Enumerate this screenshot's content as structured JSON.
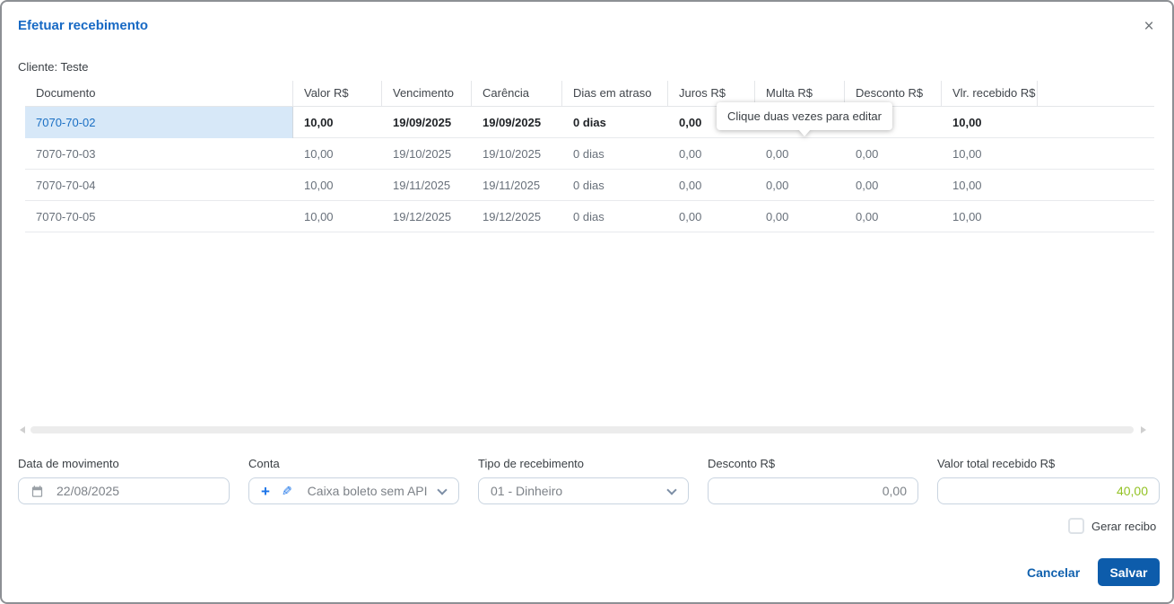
{
  "dialog": {
    "title": "Efetuar recebimento",
    "client_label": "Cliente: Teste"
  },
  "icons": {
    "close": "×",
    "plus": "+",
    "pencil": "✎"
  },
  "table": {
    "columns": [
      "Documento",
      "Valor R$",
      "Vencimento",
      "Carência",
      "Dias em atraso",
      "Juros R$",
      "Multa R$",
      "Desconto R$",
      "Vlr. recebido R$"
    ],
    "tooltip": "Clique duas vezes para editar",
    "rows": [
      {
        "documento": "7070-70-02",
        "valor": "10,00",
        "vencimento": "19/09/2025",
        "carencia": "19/09/2025",
        "dias": "0 dias",
        "juros": "0,00",
        "multa": "",
        "desconto": "",
        "recebido": "10,00"
      },
      {
        "documento": "7070-70-03",
        "valor": "10,00",
        "vencimento": "19/10/2025",
        "carencia": "19/10/2025",
        "dias": "0 dias",
        "juros": "0,00",
        "multa": "0,00",
        "desconto": "0,00",
        "recebido": "10,00"
      },
      {
        "documento": "7070-70-04",
        "valor": "10,00",
        "vencimento": "19/11/2025",
        "carencia": "19/11/2025",
        "dias": "0 dias",
        "juros": "0,00",
        "multa": "0,00",
        "desconto": "0,00",
        "recebido": "10,00"
      },
      {
        "documento": "7070-70-05",
        "valor": "10,00",
        "vencimento": "19/12/2025",
        "carencia": "19/12/2025",
        "dias": "0 dias",
        "juros": "0,00",
        "multa": "0,00",
        "desconto": "0,00",
        "recebido": "10,00"
      }
    ]
  },
  "form": {
    "data_movimento": {
      "label": "Data de movimento",
      "value": "22/08/2025"
    },
    "conta": {
      "label": "Conta",
      "value": "Caixa boleto sem API"
    },
    "tipo_recebimento": {
      "label": "Tipo de recebimento",
      "value": "01 - Dinheiro"
    },
    "desconto": {
      "label": "Desconto R$",
      "value": "0,00"
    },
    "valor_total": {
      "label": "Valor total recebido R$",
      "value": "40,00"
    }
  },
  "footer": {
    "gerar_recibo_label": "Gerar recibo",
    "cancel_label": "Cancelar",
    "save_label": "Salvar"
  },
  "colors": {
    "title_blue": "#1769c4",
    "button_blue": "#0d5cab",
    "selected_cell_bg": "#d7e8f8",
    "selected_cell_text": "#1a6fc4",
    "total_green": "#93c224"
  }
}
